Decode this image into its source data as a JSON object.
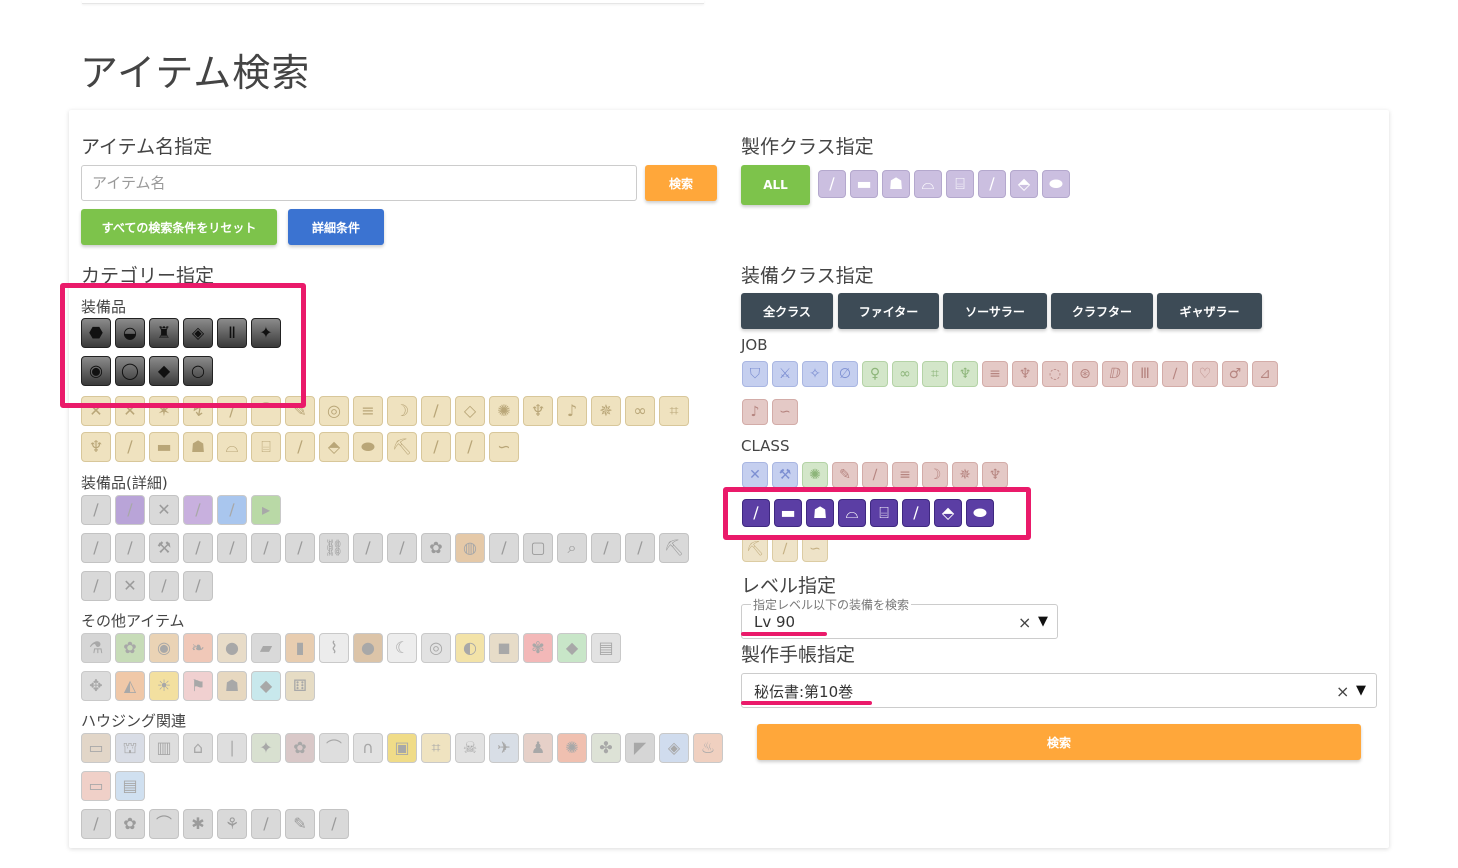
{
  "page_title": "アイテム検索",
  "name_section": {
    "title": "アイテム名指定",
    "placeholder": "アイテム名",
    "search_label": "検索",
    "reset_label": "すべての検索条件をリセット",
    "detail_label": "詳細条件"
  },
  "category_section": {
    "title": "カテゴリー指定",
    "equipment_label": "装備品",
    "equipment_detail_label": "装備品(詳細)",
    "other_items_label": "その他アイテム",
    "housing_label": "ハウジング関連"
  },
  "craft_class_section": {
    "title": "製作クラス指定",
    "all_label": "ALL"
  },
  "equip_class_section": {
    "title": "装備クラス指定",
    "buttons": [
      "全クラス",
      "ファイター",
      "ソーサラー",
      "クラフター",
      "ギャザラー"
    ],
    "job_label": "JOB",
    "class_label": "CLASS"
  },
  "level_section": {
    "title": "レベル指定",
    "legend": "指定レベル以下の装備を検索",
    "value": "Lv 90",
    "clear_glyph": "×",
    "arrow_glyph": "▼"
  },
  "notebook_section": {
    "title": "製作手帳指定",
    "value": "秘伝書:第10巻",
    "clear_glyph": "×",
    "arrow_glyph": "▼"
  },
  "bottom_search_label": "検索",
  "colors": {
    "accent_orange": "#ffa73a",
    "reset_green": "#7dc34b",
    "detail_blue": "#3b73d1",
    "class_button_dark": "#3d4b56",
    "highlight_pink": "#ea1a6a",
    "crafter_purple": "#5b3ea4"
  }
}
